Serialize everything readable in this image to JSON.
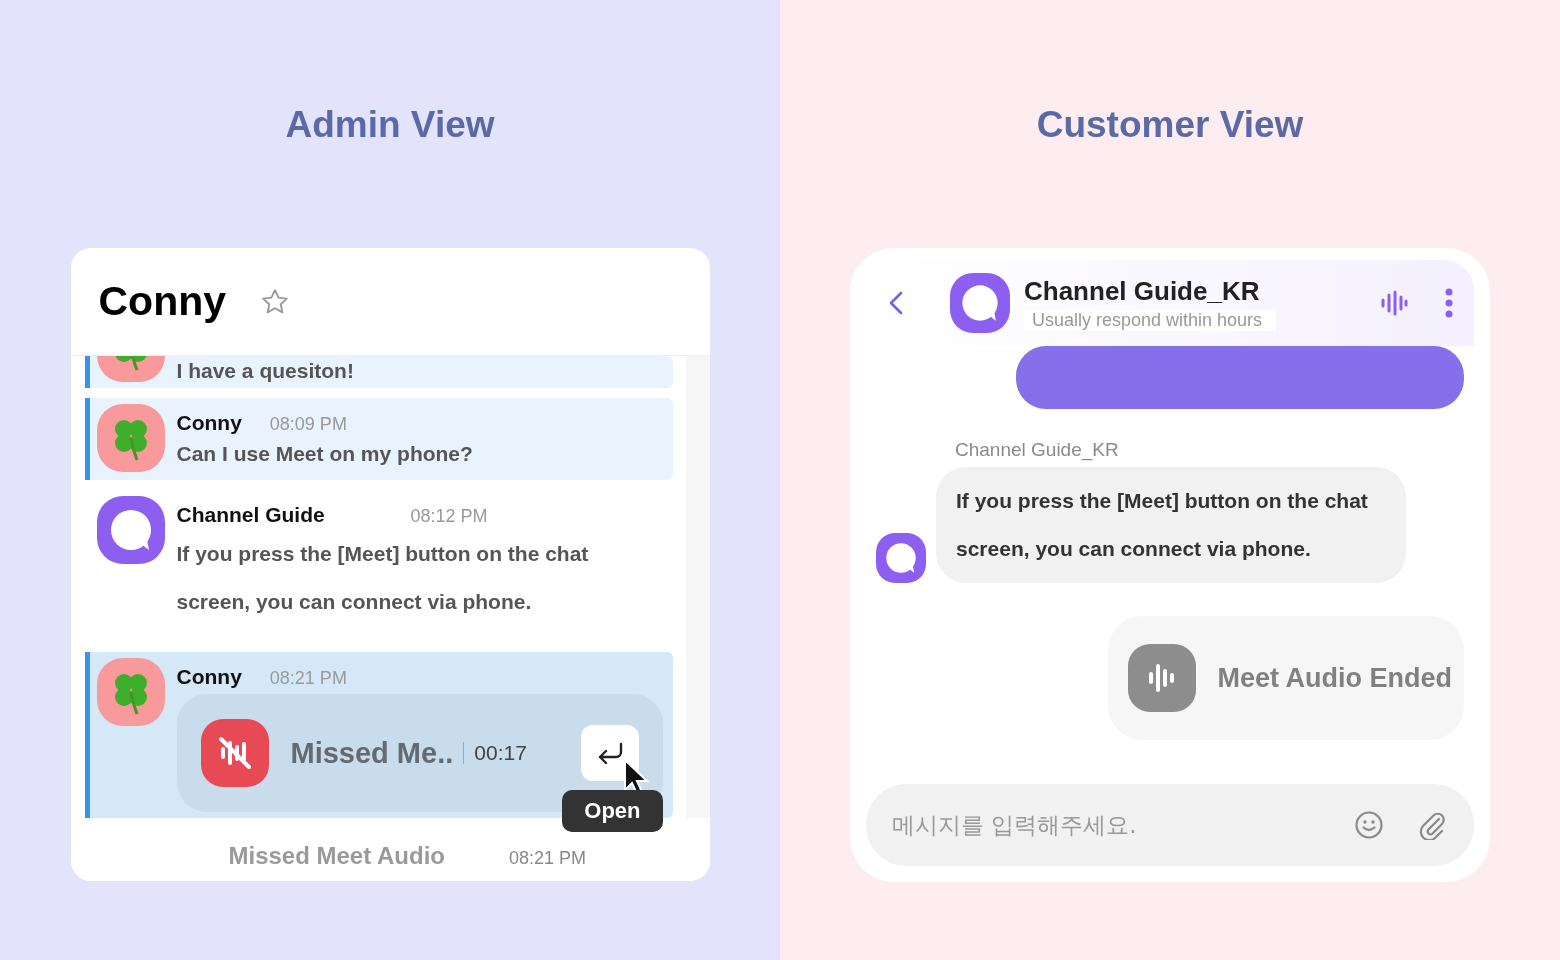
{
  "admin": {
    "heading": "Admin View",
    "title": "Conny",
    "messages": [
      {
        "kind": "text",
        "avatar": {
          "kind": "clover"
        },
        "highlighted": true,
        "hovered": false,
        "text": "I have a quesiton!"
      },
      {
        "kind": "text",
        "avatar": {
          "kind": "clover"
        },
        "highlighted": true,
        "hovered": false,
        "sender": "Conny",
        "time": "08:09 PM",
        "text": "Can I use Meet on my phone?"
      },
      {
        "kind": "text",
        "avatar": {
          "kind": "bubble"
        },
        "highlighted": false,
        "hovered": false,
        "sender": "Channel Guide",
        "time": "08:12 PM",
        "text": "If you press the [Meet] button on the chat screen, you can connect via phone."
      },
      {
        "kind": "call",
        "avatar": {
          "kind": "clover"
        },
        "highlighted": true,
        "hovered": true,
        "sender": "Conny",
        "time": "08:21 PM",
        "call": {
          "missed": true,
          "title": "Missed Me..",
          "duration": "00:17",
          "tooltip": "Open"
        }
      }
    ],
    "preview": {
      "text": "Missed Meet Audio",
      "time": "08:21 PM"
    }
  },
  "customer": {
    "heading": "Customer View",
    "header": {
      "name": "Channel Guide_KR",
      "subtitle": "Usually respond within hours"
    },
    "messages": [
      {
        "kind": "outgoing"
      },
      {
        "kind": "incoming",
        "sender": "Channel Guide_KR",
        "text": "If you press the [Meet] button on the chat screen, you can connect via phone."
      },
      {
        "kind": "call",
        "text": "Meet Audio Ended"
      }
    ],
    "input": {
      "placeholder": "메시지를 입력해주세요."
    }
  }
}
